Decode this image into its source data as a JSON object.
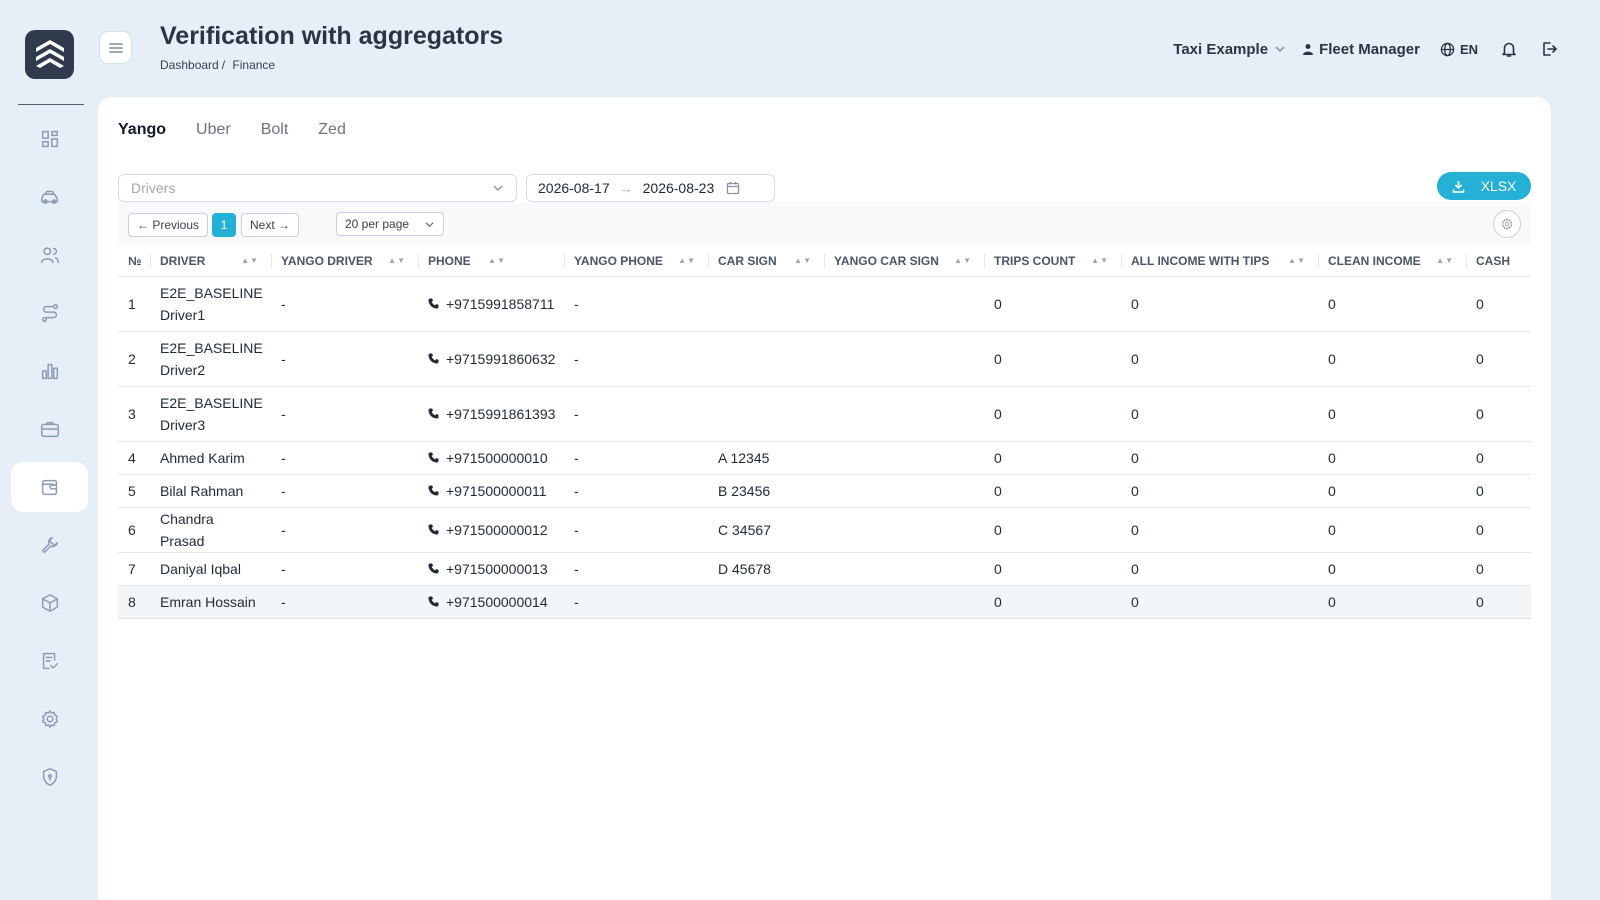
{
  "header": {
    "title": "Verification with aggregators",
    "breadcrumb": [
      "Dashboard",
      "Finance"
    ],
    "company": "Taxi Example",
    "user_role": "Fleet Manager",
    "language": "EN"
  },
  "sidebar": {
    "items": [
      "dashboard-icon",
      "car-icon",
      "users-icon",
      "route-icon",
      "chart-icon",
      "briefcase-icon",
      "wallet-icon",
      "wrench-icon",
      "box-icon",
      "checklist-icon",
      "gear-icon",
      "shield-icon"
    ],
    "active": "wallet-icon"
  },
  "tabs": [
    "Yango",
    "Uber",
    "Bolt",
    "Zed"
  ],
  "active_tab": "Yango",
  "filters": {
    "drivers_placeholder": "Drivers",
    "date_from": "2026-08-17",
    "date_arrow": "→",
    "date_to": "2026-08-23",
    "export_label": "XLSX"
  },
  "pagination": {
    "previous": "← Previous",
    "current": "1",
    "next": "Next →",
    "per_page": "20 per page"
  },
  "table": {
    "columns": [
      "№",
      "DRIVER",
      "YANGO DRIVER",
      "PHONE",
      "YANGO PHONE",
      "CAR SIGN",
      "YANGO CAR SIGN",
      "TRIPS COUNT",
      "ALL INCOME WITH TIPS",
      "CLEAN INCOME",
      "CASH"
    ],
    "rows": [
      {
        "n": "1",
        "driver_line1": "E2E_BASELINE",
        "driver_line2": "Driver1",
        "yango_driver": "-",
        "phone": "+9715991858711",
        "yango_phone": "-",
        "car_sign": "",
        "yango_car_sign": "",
        "trips": "0",
        "income_tips": "0",
        "clean_income": "0",
        "cash": "0"
      },
      {
        "n": "2",
        "driver_line1": "E2E_BASELINE",
        "driver_line2": "Driver2",
        "yango_driver": "-",
        "phone": "+9715991860632",
        "yango_phone": "-",
        "car_sign": "",
        "yango_car_sign": "",
        "trips": "0",
        "income_tips": "0",
        "clean_income": "0",
        "cash": "0"
      },
      {
        "n": "3",
        "driver_line1": "E2E_BASELINE",
        "driver_line2": "Driver3",
        "yango_driver": "-",
        "phone": "+9715991861393",
        "yango_phone": "-",
        "car_sign": "",
        "yango_car_sign": "",
        "trips": "0",
        "income_tips": "0",
        "clean_income": "0",
        "cash": "0"
      },
      {
        "n": "4",
        "driver_line1": "Ahmed Karim",
        "driver_line2": "",
        "yango_driver": "-",
        "phone": "+971500000010",
        "yango_phone": "-",
        "car_sign": "A 12345",
        "yango_car_sign": "",
        "trips": "0",
        "income_tips": "0",
        "clean_income": "0",
        "cash": "0"
      },
      {
        "n": "5",
        "driver_line1": "Bilal Rahman",
        "driver_line2": "",
        "yango_driver": "-",
        "phone": "+971500000011",
        "yango_phone": "-",
        "car_sign": "B 23456",
        "yango_car_sign": "",
        "trips": "0",
        "income_tips": "0",
        "clean_income": "0",
        "cash": "0"
      },
      {
        "n": "6",
        "driver_line1": "Chandra Prasad",
        "driver_line2": "",
        "yango_driver": "-",
        "phone": "+971500000012",
        "yango_phone": "-",
        "car_sign": "C 34567",
        "yango_car_sign": "",
        "trips": "0",
        "income_tips": "0",
        "clean_income": "0",
        "cash": "0"
      },
      {
        "n": "7",
        "driver_line1": "Daniyal Iqbal",
        "driver_line2": "",
        "yango_driver": "-",
        "phone": "+971500000013",
        "yango_phone": "-",
        "car_sign": "D 45678",
        "yango_car_sign": "",
        "trips": "0",
        "income_tips": "0",
        "clean_income": "0",
        "cash": "0"
      },
      {
        "n": "8",
        "driver_line1": "Emran Hossain",
        "driver_line2": "",
        "yango_driver": "-",
        "phone": "+971500000014",
        "yango_phone": "-",
        "car_sign": "",
        "yango_car_sign": "",
        "trips": "0",
        "income_tips": "0",
        "clean_income": "0",
        "cash": "0"
      }
    ]
  },
  "colors": {
    "accent": "#25b1d6",
    "background": "#e6eef7",
    "logo_bg": "#2f3b4c"
  }
}
